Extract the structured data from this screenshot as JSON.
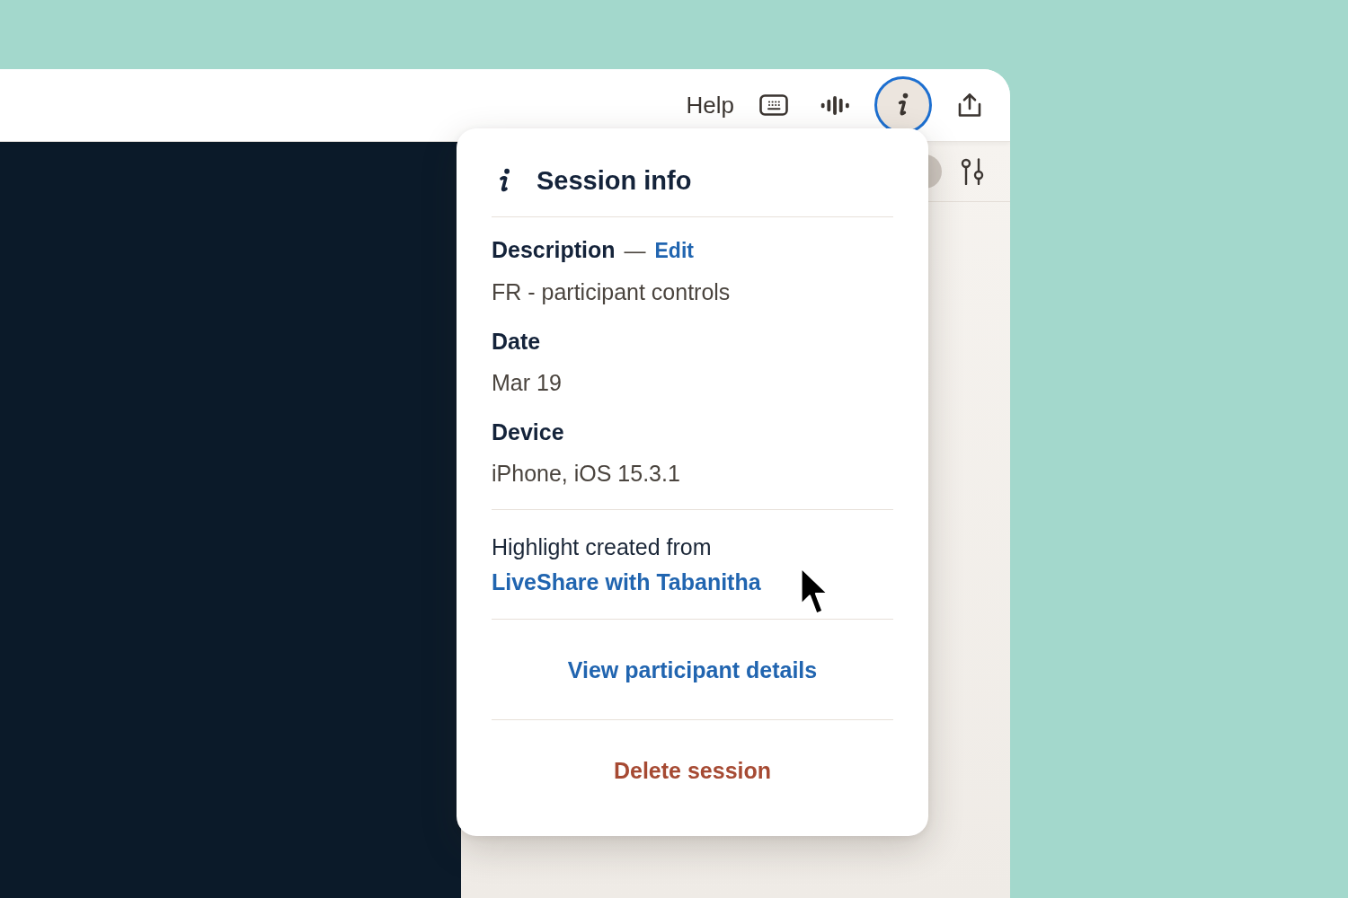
{
  "toolbar": {
    "help": "Help",
    "icon_buttons": [
      {
        "kind": "keyboard",
        "selected": false
      },
      {
        "kind": "waveform",
        "selected": false
      },
      {
        "kind": "info",
        "selected": true
      },
      {
        "kind": "share",
        "selected": false
      }
    ]
  },
  "session_info": {
    "title": "Session info",
    "fields": [
      {
        "label": "Description",
        "separator": "—",
        "action": "Edit",
        "value": "FR - participant controls"
      },
      {
        "label": "Date",
        "value": "Mar 19"
      },
      {
        "label": "Device",
        "value": "iPhone, iOS 15.3.1"
      }
    ],
    "source": {
      "text": "Highlight created from",
      "link": "LiveShare with Tabanitha"
    },
    "actions": [
      {
        "kind": "link",
        "label": "View participant details"
      },
      {
        "kind": "danger",
        "label": "Delete session"
      }
    ]
  }
}
